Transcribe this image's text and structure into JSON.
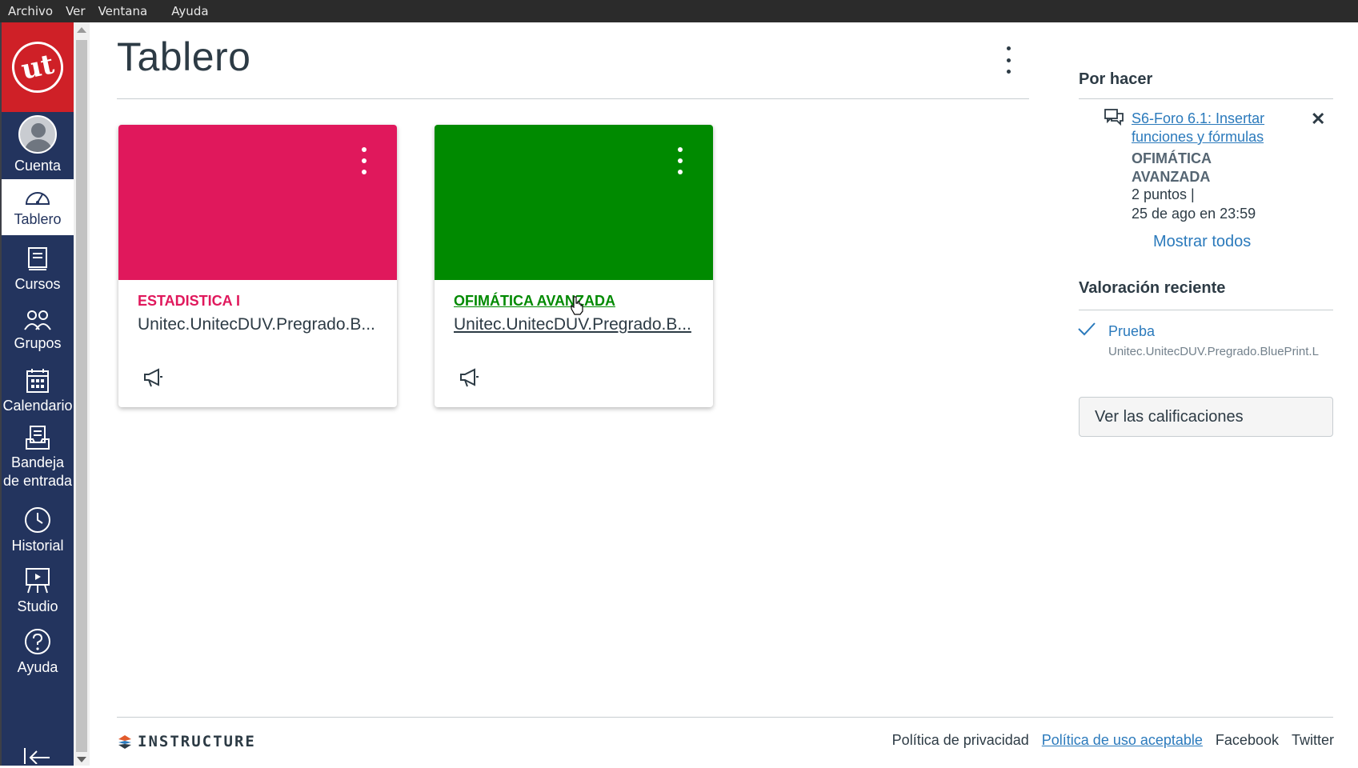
{
  "menubar": {
    "items": [
      "Archivo",
      "Ver",
      "Ventana",
      "Ayuda"
    ]
  },
  "brand": {
    "logo_text": "ut"
  },
  "nav": {
    "account": "Cuenta",
    "dashboard": "Tablero",
    "courses": "Cursos",
    "groups": "Grupos",
    "calendar": "Calendario",
    "inbox_line1": "Bandeja",
    "inbox_line2": "de entrada",
    "history": "Historial",
    "studio": "Studio",
    "help": "Ayuda"
  },
  "main": {
    "title": "Tablero"
  },
  "cards": [
    {
      "title": "ESTADISTICA I",
      "subtitle": "Unitec.UnitecDUV.Pregrado.B...",
      "color": "#e0185c"
    },
    {
      "title": "OFIMÁTICA AVANZADA",
      "subtitle": "Unitec.UnitecDUV.Pregrado.B...",
      "color": "#008a00"
    }
  ],
  "sidebar": {
    "todo_heading": "Por hacer",
    "todo_link": "S6-Foro 6.1: Insertar funciones y fórmulas",
    "todo_course": "OFIMÁTICA AVANZADA",
    "todo_points": "2 puntos  |",
    "todo_due": "25 de ago en 23:59",
    "show_all": "Mostrar todos",
    "grades_heading": "Valoración reciente",
    "grade_item": "Prueba",
    "grade_course": "Unitec.UnitecDUV.Pregrado.BluePrint.L",
    "grades_button": "Ver las calificaciones"
  },
  "footer": {
    "brand": "INSTRUCTURE",
    "privacy": "Política de privacidad",
    "acceptable_use": "Política de uso aceptable",
    "facebook": "Facebook",
    "twitter": "Twitter"
  },
  "colors": {
    "nav_bg": "#23345e",
    "brand_red": "#cf2027",
    "link": "#2b7abc"
  }
}
